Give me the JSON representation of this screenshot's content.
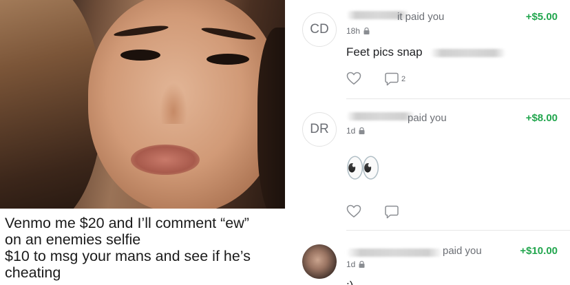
{
  "post": {
    "caption": [
      "Venmo me $20 and I’ll comment “ew”",
      "on an enemies selfie",
      "$10 to msg your mans and see if he’s",
      "cheating"
    ]
  },
  "feed": {
    "transactions": [
      {
        "avatar_initials": "CD",
        "action_text": "it paid you",
        "amount": "+$5.00",
        "time": "18h",
        "note": "Feet pics snap",
        "comment_count": "2"
      },
      {
        "avatar_initials": "DR",
        "action_text": "paid you",
        "amount": "+$8.00",
        "time": "1d",
        "note_emoji": "👀",
        "comment_count": ""
      },
      {
        "avatar_initials": "",
        "action_text": "paid you",
        "amount": "+$10.00",
        "time": "1d",
        "note_partial": ";)"
      }
    ]
  },
  "colors": {
    "amount_green": "#22a64e",
    "muted_text": "#6b6e74",
    "divider": "#e6e6e6"
  },
  "icons": [
    "lock-icon",
    "heart-icon",
    "comment-icon"
  ]
}
